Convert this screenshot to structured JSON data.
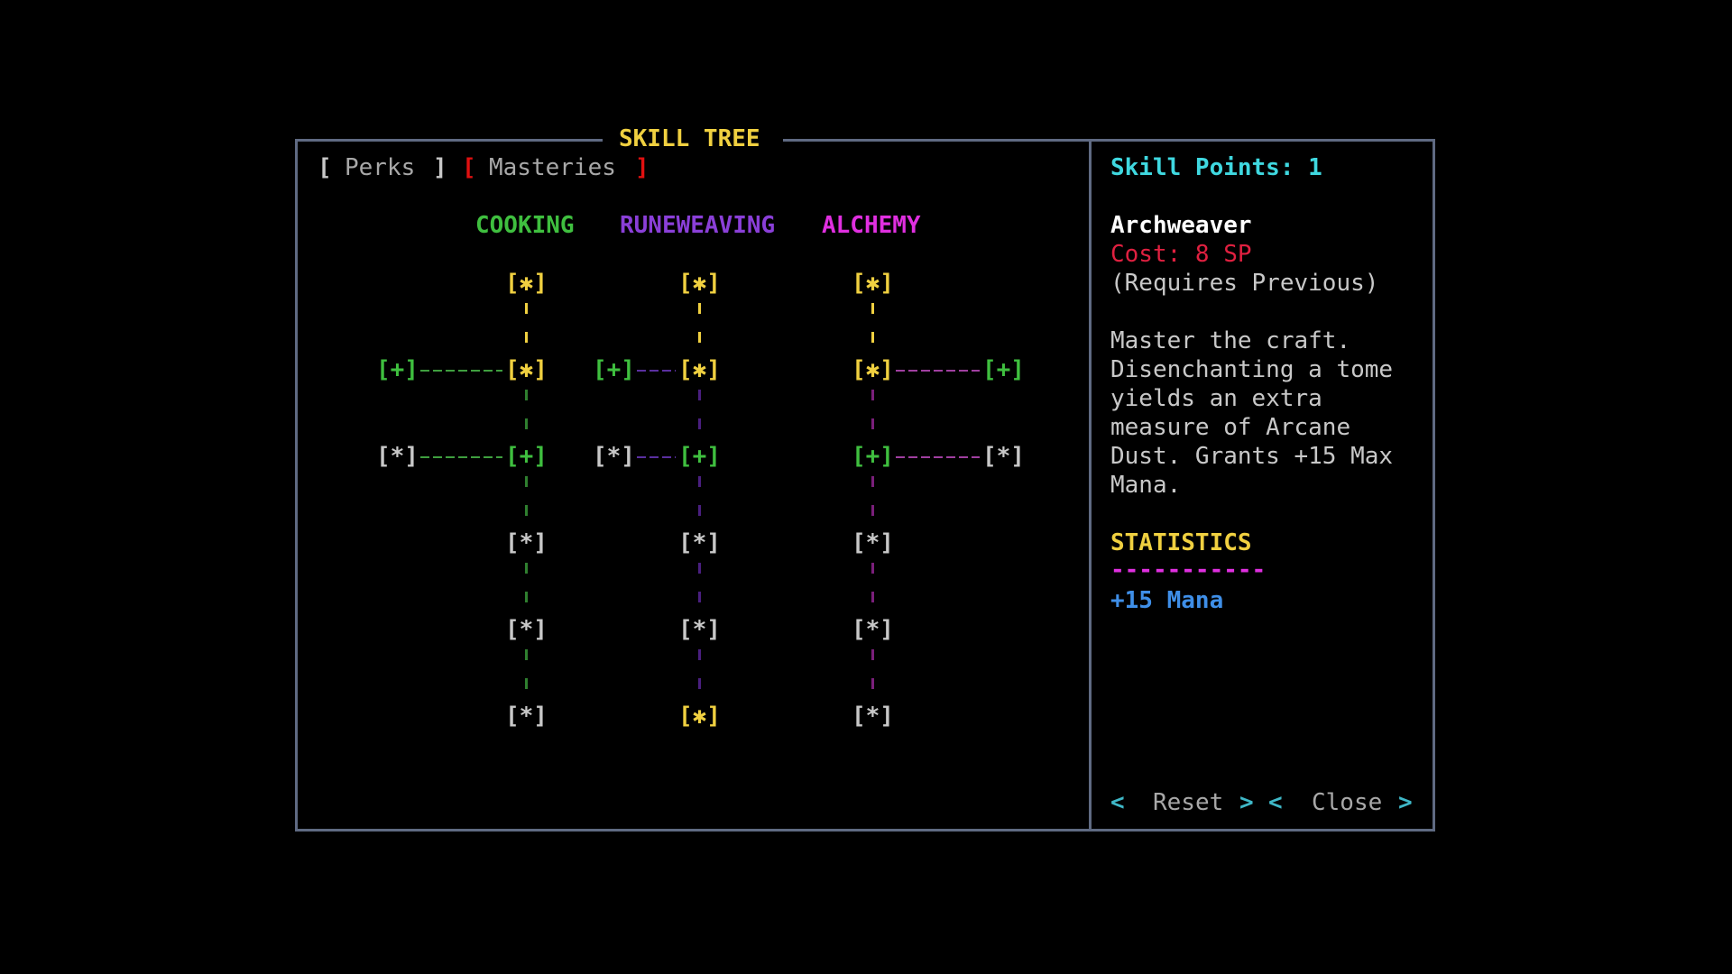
{
  "window": {
    "title": "SKILL TREE",
    "tabs": [
      {
        "label": "Perks",
        "active": false
      },
      {
        "label": "Masteries",
        "active": true
      }
    ]
  },
  "trees": [
    {
      "name": "COOKING",
      "color": "#3fbf3f"
    },
    {
      "name": "RUNEWEAVING",
      "color": "#8a3fd8"
    },
    {
      "name": "ALCHEMY",
      "color": "#e02fe0"
    }
  ],
  "node_glyphs": {
    "mastered": "[✱]",
    "unlocked": "[+]",
    "locked": "[*]",
    "connector": "¦"
  },
  "node_states": {
    "cooking": [
      "mastered",
      "mastered",
      "unlocked",
      "locked",
      "locked",
      "locked"
    ],
    "cooking_branch": [
      "unlocked",
      "locked"
    ],
    "runeweaving": [
      "mastered",
      "mastered",
      "unlocked",
      "locked",
      "locked",
      "mastered"
    ],
    "runeweaving_branch": [
      "unlocked",
      "locked"
    ],
    "alchemy": [
      "mastered",
      "mastered",
      "unlocked",
      "locked",
      "locked",
      "locked"
    ],
    "alchemy_branch": [
      "unlocked",
      "locked"
    ]
  },
  "details": {
    "skill_points_label": "Skill Points: 1",
    "name": "Archweaver",
    "cost": "Cost: 8 SP",
    "requirement": "(Requires Previous)",
    "description": [
      "Master the craft.",
      "Disenchanting a tome",
      "yields an extra",
      "measure of Arcane",
      "Dust. Grants +15 Max",
      "Mana."
    ],
    "stats_header": "STATISTICS",
    "stats_rule": "-----------",
    "stats": [
      "+15 Mana"
    ]
  },
  "buttons": {
    "reset_label": "Reset",
    "close_label": "Close"
  },
  "colors": {
    "border": "#5f6a82",
    "mastered": "#f0d040",
    "unlocked": "#3fbf3f",
    "locked": "#c8c8c8",
    "title": "#f0d040",
    "skill_points": "#3fd8e0",
    "cost": "#e02040",
    "stat": "#3f8fe8",
    "bracket_active": "#e01010"
  }
}
